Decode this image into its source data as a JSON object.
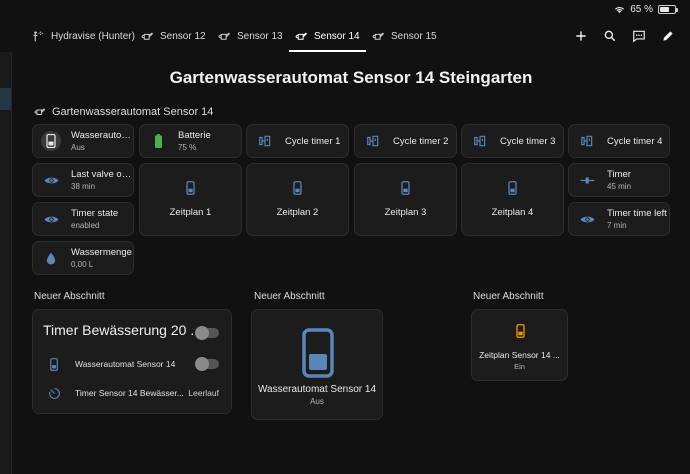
{
  "status": {
    "battery_text": "65 %",
    "battery_level": 0.65
  },
  "tabs": [
    {
      "label": "Hydravise (Hunter)",
      "icon": "sprinkler-icon",
      "active": false
    },
    {
      "label": "Sensor 12",
      "icon": "watering-can-icon",
      "active": false
    },
    {
      "label": "Sensor 13",
      "icon": "watering-can-icon",
      "active": false
    },
    {
      "label": "Sensor 14",
      "icon": "watering-can-icon",
      "active": true
    },
    {
      "label": "Sensor 15",
      "icon": "watering-can-icon",
      "active": false
    }
  ],
  "toolbar_icons": [
    "plus-icon",
    "search-icon",
    "assist-icon",
    "edit-icon"
  ],
  "page_title": "Gartenwasserautomat Sensor 14 Steingarten",
  "device_group": {
    "title": "Gartenwasserautomat Sensor 14",
    "tiles": {
      "wasserautomat": {
        "name": "Wasserautom...",
        "state": "Aus",
        "icon": "water-valve-icon"
      },
      "batterie": {
        "name": "Batterie",
        "state": "75 %",
        "icon": "battery-icon",
        "color": "#4caf50"
      },
      "cycle1": {
        "name": "Cycle timer 1",
        "icon": "timer-switch-icon"
      },
      "cycle2": {
        "name": "Cycle timer 2",
        "icon": "timer-switch-icon"
      },
      "cycle3": {
        "name": "Cycle timer 3",
        "icon": "timer-switch-icon"
      },
      "cycle4": {
        "name": "Cycle timer 4",
        "icon": "timer-switch-icon"
      },
      "last_valve": {
        "name": "Last valve ope...",
        "state": "38 min",
        "icon": "eye-icon"
      },
      "timer_state": {
        "name": "Timer state",
        "state": "enabled",
        "icon": "eye-icon"
      },
      "wassermenge": {
        "name": "Wassermenge",
        "state": "0,00 L",
        "icon": "water-drop-icon"
      },
      "timer": {
        "name": "Timer",
        "state": "45 min",
        "icon": "slider-icon"
      },
      "timer_left": {
        "name": "Timer time left",
        "state": "7 min",
        "icon": "eye-icon"
      }
    },
    "schedules": [
      {
        "label": "Zeitplan 1",
        "icon": "phone-icon"
      },
      {
        "label": "Zeitplan 2",
        "icon": "phone-icon"
      },
      {
        "label": "Zeitplan 3",
        "icon": "phone-icon"
      },
      {
        "label": "Zeitplan 4",
        "icon": "phone-icon"
      }
    ]
  },
  "sections": [
    {
      "label": "Neuer Abschnitt",
      "entities_card": {
        "title": "Timer Bewässerung 20 ...",
        "rows": [
          {
            "name": "Wasserautomat Sensor 14",
            "icon": "phone-icon",
            "control": "toggle"
          },
          {
            "name": "Timer Sensor 14 Bewässer...",
            "icon": "timer-icon",
            "state": "Leerlauf"
          }
        ]
      }
    },
    {
      "label": "Neuer Abschnitt",
      "button_card": {
        "name": "Wasserautomat Sensor 14",
        "state": "Aus",
        "icon": "phone-icon"
      }
    },
    {
      "label": "Neuer Abschnitt",
      "button_card": {
        "name": "Zeitplan Sensor 14 ...",
        "state": "Ein",
        "icon": "phone-icon",
        "color": "#ff9800"
      }
    }
  ],
  "colors": {
    "accent_blue": "#5b86b8",
    "active_orange": "#ff9800",
    "battery_green": "#4caf50",
    "icon_gray": "#b8b8b8"
  }
}
